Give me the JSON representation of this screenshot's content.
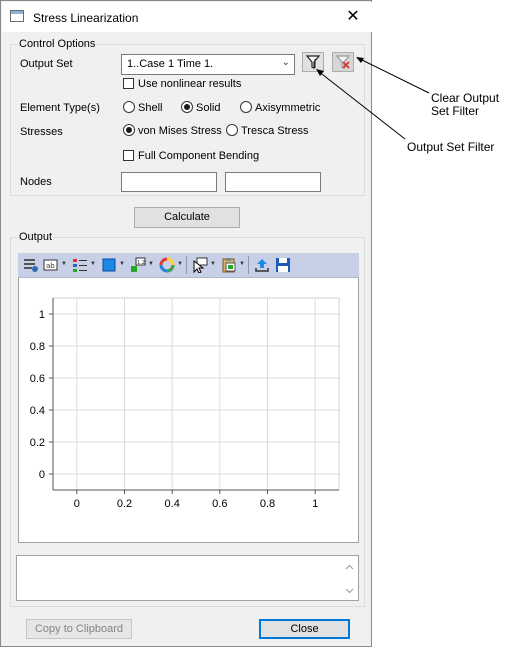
{
  "window": {
    "title": "Stress Linearization",
    "close_glyph": "✕"
  },
  "control_options": {
    "group_label": "Control Options",
    "output_set_label": "Output Set",
    "output_set_value": "1..Case 1 Time 1.",
    "use_nonlinear_label": "Use nonlinear results",
    "element_types_label": "Element Type(s)",
    "element_types": [
      "Shell",
      "Solid",
      "Axisymmetric"
    ],
    "element_type_selected": "Solid",
    "stresses_label": "Stresses",
    "stresses": [
      "von Mises Stress",
      "Tresca Stress"
    ],
    "stress_selected": "von Mises Stress",
    "full_component_label": "Full Component Bending",
    "nodes_label": "Nodes",
    "node1_value": "",
    "node2_value": ""
  },
  "calculate_label": "Calculate",
  "output": {
    "group_label": "Output",
    "toolbar_icons": [
      "chart-properties-icon",
      "data-labels-icon",
      "legend-icon",
      "color-icon",
      "value-format-icon",
      "palette-icon",
      "select-pointer-icon",
      "clipboard-icon",
      "export-icon",
      "save-icon"
    ]
  },
  "chart_data": {
    "type": "line",
    "series": [],
    "x_ticks": [
      "0",
      "0.2",
      "0.4",
      "0.6",
      "0.8",
      "1"
    ],
    "y_ticks": [
      "0",
      "0.2",
      "0.4",
      "0.6",
      "0.8",
      "1"
    ],
    "xlim": [
      -0.1,
      1.1
    ],
    "ylim": [
      -0.1,
      1.1
    ],
    "grid": true
  },
  "footer": {
    "copy_label": "Copy to Clipboard",
    "close_label": "Close"
  },
  "annotations": {
    "clear_filter": [
      "Clear Output",
      "Set Filter"
    ],
    "set_filter": "Output Set Filter"
  },
  "colors": {
    "dialog_bg": "#f0f0f0",
    "toolbar_bg": "#c7d0e6",
    "accent_blue": "#0078d7"
  }
}
